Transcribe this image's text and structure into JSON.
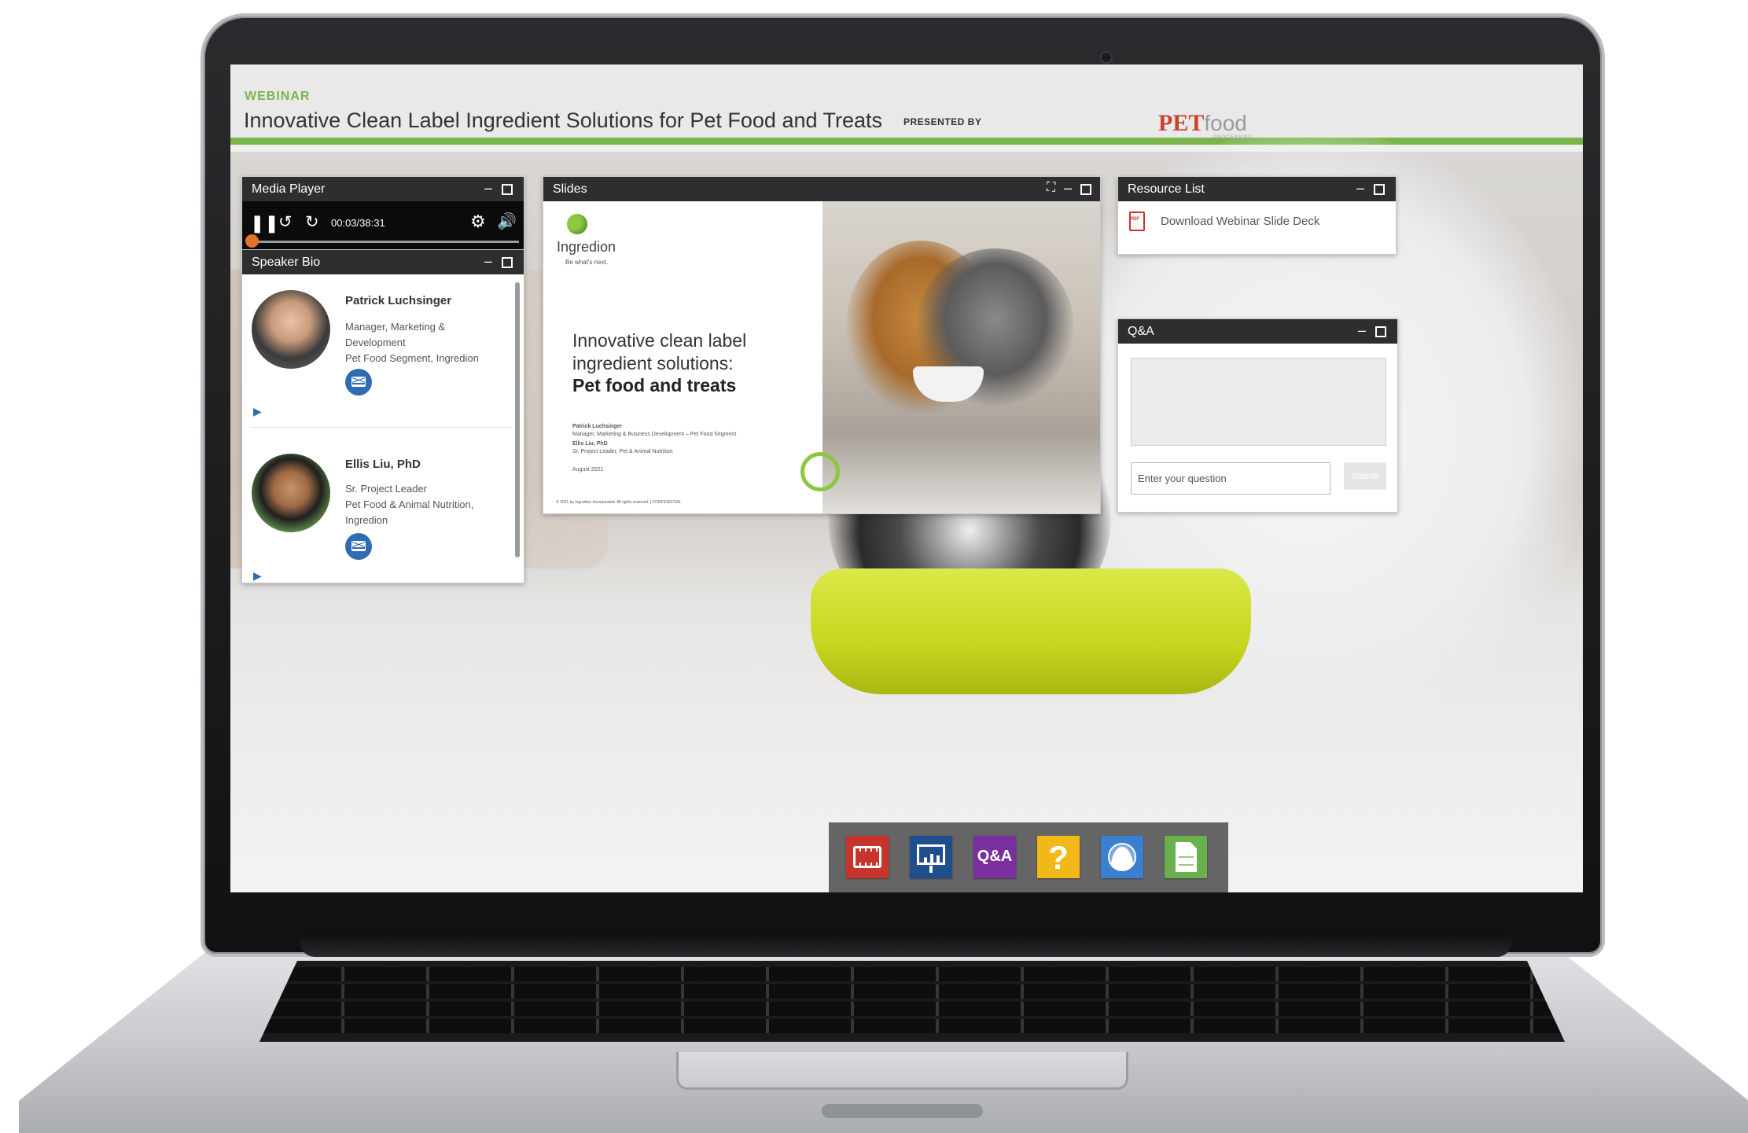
{
  "header": {
    "eyebrow": "WEBINAR",
    "title": "Innovative Clean Label Ingredient Solutions for Pet Food and Treats",
    "presented_by": "PRESENTED BY",
    "logo_main": "PET",
    "logo_light": "food",
    "logo_sub": "PROCESSING"
  },
  "media_player": {
    "title": "Media Player",
    "time": "00:03/38:31",
    "progress": 0.0013,
    "icons": [
      "pause-icon",
      "rewind-icon",
      "forward-icon",
      "gear-icon",
      "volume-icon"
    ]
  },
  "speaker_bio": {
    "title": "Speaker Bio",
    "speakers": [
      {
        "name": "Patrick Luchsinger",
        "role": "Manager, Marketing & Development",
        "org": "Pet Food Segment, Ingredion"
      },
      {
        "name": "Ellis Liu, PhD",
        "role": "Sr. Project Leader",
        "org": "Pet Food & Animal Nutrition, Ingredion"
      }
    ]
  },
  "slides": {
    "title": "Slides",
    "brand": "Ingredion",
    "tagline": "Be what's next.",
    "heading_line1": "Innovative clean label",
    "heading_line2": "ingredient solutions:",
    "heading_bold": "Pet food and treats",
    "presenter1_name": "Patrick Luchsinger",
    "presenter1_title": "Manager, Marketing & Business Development – Pet Food Segment",
    "presenter2_name": "Ellis Liu, PhD",
    "presenter2_title": "Sr. Project Leader, Pet & Animal Nutrition",
    "date": "August 2021",
    "footer": "© 2021 by Ingredion Incorporated. All rights reserved. | CONFIDENTIAL"
  },
  "resource_list": {
    "title": "Resource List",
    "items": [
      {
        "label": "Download Webinar Slide Deck",
        "icon": "pdf-icon"
      }
    ]
  },
  "qa": {
    "title": "Q&A",
    "placeholder": "Enter your question",
    "submit": "Submit"
  },
  "window_controls": {
    "minimize": "–"
  },
  "dock": {
    "items": [
      {
        "name": "media-player",
        "color": "#c8342c",
        "icon": "film-icon"
      },
      {
        "name": "slides",
        "color": "#1f4e8c",
        "icon": "presentation-icon"
      },
      {
        "name": "qa",
        "color": "#7a2f9e",
        "label": "Q&A"
      },
      {
        "name": "help",
        "color": "#f2b817",
        "label": "?"
      },
      {
        "name": "speaker-bio",
        "color": "#3b7fd1",
        "icon": "person-icon"
      },
      {
        "name": "resources",
        "color": "#6ab04c",
        "icon": "document-icon"
      }
    ]
  }
}
